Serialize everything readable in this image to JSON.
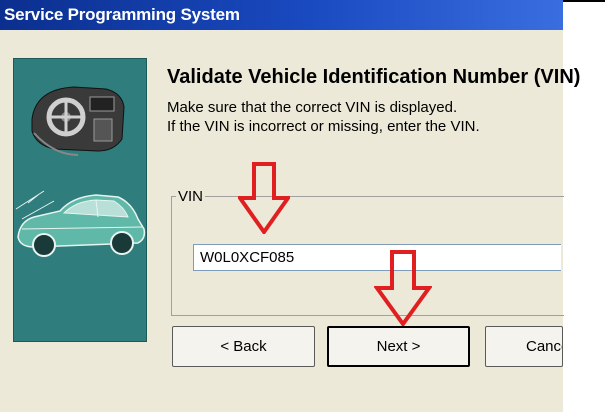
{
  "window": {
    "title": "Service Programming System"
  },
  "page": {
    "heading": "Validate Vehicle Identification Number (VIN)",
    "instruction_line1": "Make sure that the correct VIN is displayed.",
    "instruction_line2": "If the VIN is incorrect or missing, enter the VIN."
  },
  "vin_group": {
    "label": "VIN",
    "value": "W0L0XCF085"
  },
  "buttons": {
    "back": "< Back",
    "next": "Next >",
    "cancel": "Cancel"
  },
  "colors": {
    "titlebar": "#0b2f8f",
    "left_panel": "#2f7d7d",
    "window_bg": "#ece9d8",
    "annotation_arrow": "#e02020"
  },
  "icons": [
    "dashboard-icon",
    "car-icon",
    "down-arrow-annotation"
  ]
}
